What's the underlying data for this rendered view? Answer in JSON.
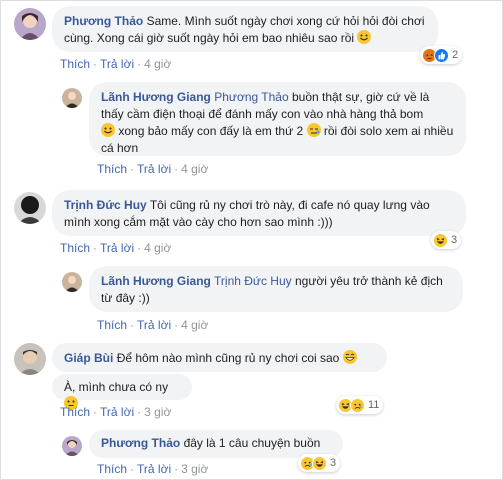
{
  "comments": [
    {
      "author": "Phương Thảo",
      "text": "Same. Mình suốt ngày chơi xong cứ hỏi hỏi đòi chơi cùng. Xong cái giờ suốt ngày hỏi em bao nhiêu sao rồi",
      "actions": {
        "like": "Thích",
        "reply": "Trả lời",
        "time": "4 giờ"
      },
      "reactions": {
        "count": "2",
        "icons": [
          "angry-icon",
          "like-icon"
        ]
      }
    },
    {
      "author": "Lãnh Hương Giang",
      "tag": "Phương Thảo",
      "text_1": "buồn thật sự, giờ cứ về là thấy cầm điện thoại để đánh mấy con vào nhà hàng thả bom",
      "text_2": "xong bảo mấy con đấy là em thứ 2",
      "text_3": "rồi đòi solo xem ai nhiều cá hơn",
      "actions": {
        "like": "Thích",
        "reply": "Trả lời",
        "time": "4 giờ"
      }
    },
    {
      "author": "Trịnh Đức Huy",
      "text": "Tôi cũng rủ ny chơi trò này, đi cafe nó quay lưng vào mình xong cắm mặt vào cày cho hơn sao mình :)))",
      "actions": {
        "like": "Thích",
        "reply": "Trả lời",
        "time": "4 giờ"
      },
      "reactions": {
        "count": "3",
        "icons": [
          "haha-icon"
        ]
      }
    },
    {
      "author": "Lãnh Hương Giang",
      "tag": "Trịnh Đức Huy",
      "text": "người yêu trở thành kẻ địch từ đây :))",
      "actions": {
        "like": "Thích",
        "reply": "Trả lời",
        "time": "4 giờ"
      }
    },
    {
      "author": "Giáp Bùi",
      "text": "Để hôm nào mình cũng rủ ny chơi coi sao",
      "text_second": "À, mình chưa có ny",
      "actions": {
        "like": "Thích",
        "reply": "Trả lời",
        "time": "3 giờ"
      },
      "reactions": {
        "count": "11",
        "icons": [
          "haha-icon",
          "sad-icon"
        ]
      }
    },
    {
      "author": "Phương Thảo",
      "text": "đây là 1 câu chuyện buồn",
      "actions": {
        "like": "Thích",
        "reply": "Trả lời",
        "time": "3 giờ"
      },
      "reactions": {
        "count": "3",
        "icons": [
          "haha-icon",
          "sad-icon"
        ]
      }
    }
  ]
}
